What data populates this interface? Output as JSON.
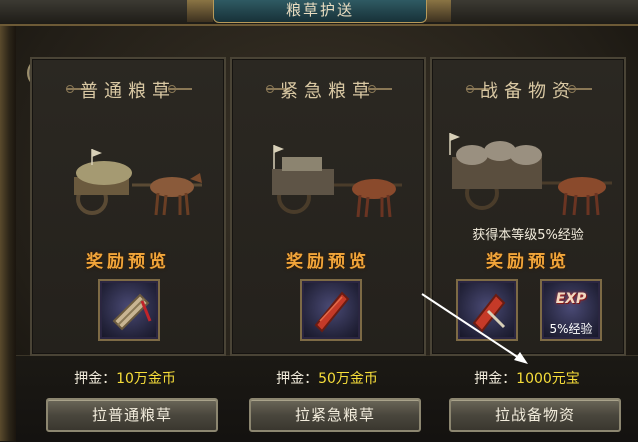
{
  "window": {
    "title": "粮草护送"
  },
  "help": {
    "icon": "question-icon",
    "label": "?"
  },
  "panels": [
    {
      "title": "普通粮草",
      "reward_title": "奖励预览",
      "rewards": [
        {
          "icon": "grain-sack-icon",
          "caption": ""
        }
      ],
      "bonus_text": "",
      "deposit_label": "押金：",
      "deposit_value": "10万金币",
      "button_label": "拉普通粮草"
    },
    {
      "title": "紧急粮草",
      "reward_title": "奖励预览",
      "rewards": [
        {
          "icon": "red-scroll-icon",
          "caption": ""
        }
      ],
      "bonus_text": "",
      "deposit_label": "押金：",
      "deposit_value": "50万金币",
      "button_label": "拉紧急粮草"
    },
    {
      "title": "战备物资",
      "reward_title": "奖励预览",
      "rewards": [
        {
          "icon": "red-token-icon",
          "caption": ""
        },
        {
          "icon": "exp-icon",
          "label": "EXP",
          "caption": "5%经验"
        }
      ],
      "bonus_text": "获得本等级5%经验",
      "deposit_label": "押金：",
      "deposit_value": "1000元宝",
      "button_label": "拉战备物资"
    }
  ],
  "colors": {
    "deposit_value": "#f7de3a",
    "reward_title": "#f2a53a",
    "title_plate": "#2f5a63"
  }
}
